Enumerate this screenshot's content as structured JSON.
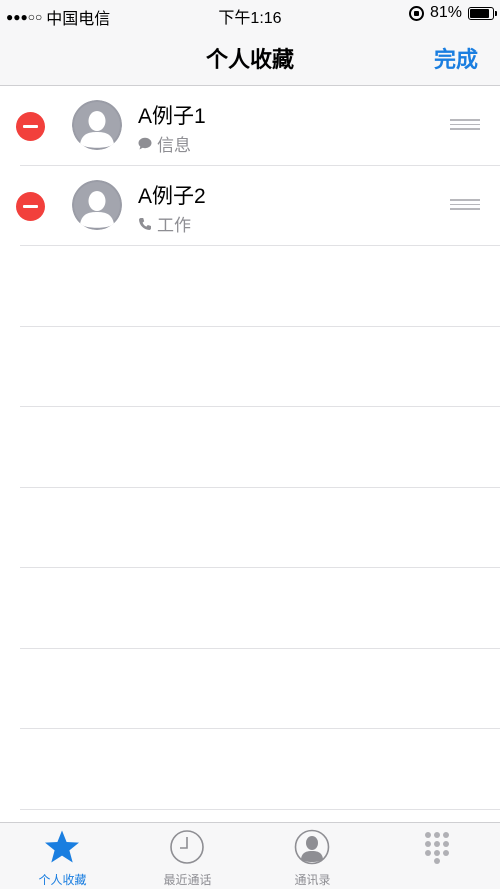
{
  "status_bar": {
    "signal_dots": "●●●○○",
    "carrier": "中国电信",
    "time": "下午1:16",
    "battery_text": "81%",
    "battery_level": 0.81
  },
  "nav": {
    "title": "个人收藏",
    "done_label": "完成"
  },
  "favorites": [
    {
      "name": "A例子1",
      "type_label": "信息",
      "type_icon": "message-bubble-icon"
    },
    {
      "name": "A例子2",
      "type_label": "工作",
      "type_icon": "phone-icon"
    }
  ],
  "tabs": [
    {
      "label": "个人收藏",
      "icon": "star-icon",
      "active": true
    },
    {
      "label": "最近通话",
      "icon": "clock-icon",
      "active": false
    },
    {
      "label": "通讯录",
      "icon": "contact-icon",
      "active": false
    },
    {
      "label": "",
      "icon": "keypad-icon",
      "active": false
    }
  ],
  "colors": {
    "accent": "#1a7ee0",
    "delete": "#f2403c",
    "secondary_text": "#8e8e93"
  }
}
